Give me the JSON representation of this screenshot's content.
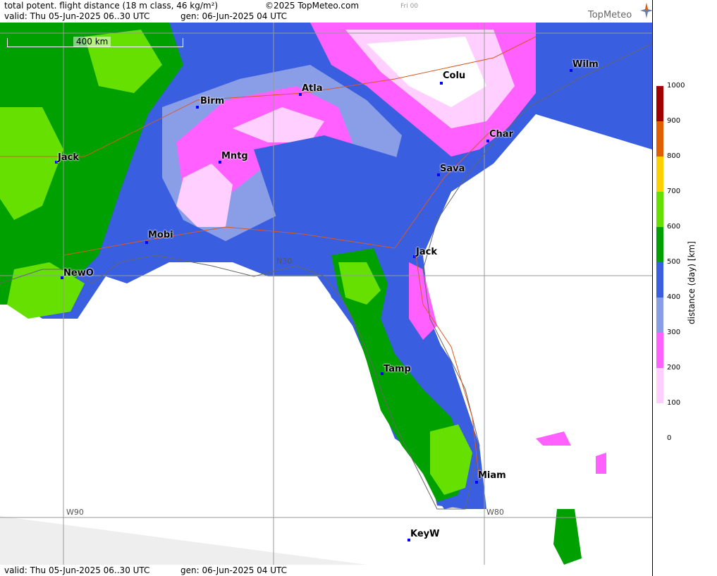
{
  "header": {
    "title": "total potent. flight distance (18 m class, 46 kg/m²)",
    "copyright": "©2025 TopMeteo.com",
    "valid": "valid:  Thu  05-Jun-2025  06..30 UTC",
    "gen": "gen: 06-Jun-2025 04 UTC",
    "frame": "Fri 00",
    "logo": "TopMeteo"
  },
  "footer": {
    "valid": "valid:  Thu  05-Jun-2025  06..30 UTC",
    "gen": "gen: 06-Jun-2025 04 UTC"
  },
  "map": {
    "scale_label": "400 km",
    "grid_labels": {
      "lon90": "W90",
      "lon80": "W80",
      "lat30": "N30"
    },
    "cities": [
      "NewO",
      "Jack",
      "Birm",
      "Atla",
      "Mntg",
      "Mobi",
      "Colu",
      "Wilm",
      "Char",
      "Sava",
      "Jack",
      "Tamp",
      "Miam",
      "KeyW"
    ]
  },
  "legend": {
    "axis_label": "distance (day) [km]",
    "ticks": [
      "1000",
      "900",
      "800",
      "700",
      "600",
      "500",
      "400",
      "300",
      "200",
      "100",
      "0"
    ],
    "colors": [
      "#a00000",
      "#e06000",
      "#ffd000",
      "#66e000",
      "#00a000",
      "#3a5ee0",
      "#8a9ee8",
      "#ff60ff",
      "#ffd0ff"
    ]
  }
}
